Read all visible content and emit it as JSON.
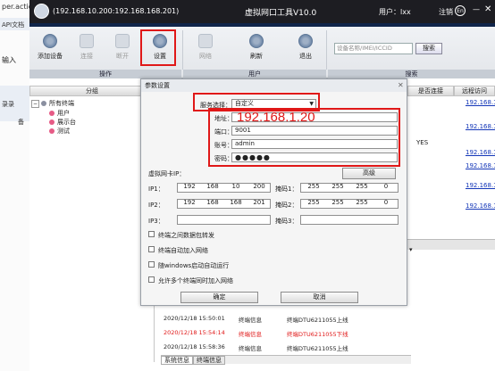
{
  "browser": {
    "url_fragment": "per.actio",
    "tab_fragment": "API文档",
    "input_fragment": "输入",
    "side_fragment": "录录",
    "side_fragment2": "备"
  },
  "window": {
    "title": "(192.168.10.200:192.168.168.201)",
    "app_name": "虚拟网口工具V10.0",
    "user_label": "用户：lxx",
    "logout": "注销",
    "lang": "En"
  },
  "toolbar": {
    "add": "添加设备",
    "connect": "连接",
    "disconnect": "断开",
    "settings": "设置",
    "network": "网络",
    "refresh": "刷新",
    "exit": "退出",
    "search_placeholder": "设备名称/IMEI/ICCID",
    "search_button": "搜索",
    "group_operate": "操作",
    "group_user": "用户",
    "group_search": "搜索"
  },
  "tree": {
    "header": "分组",
    "root": "所有终端",
    "items": [
      "用户",
      "展示台",
      "测试"
    ]
  },
  "table": {
    "col_connect": "是否连接",
    "col_remote": "远程访问",
    "yes": "YES",
    "links": [
      "192.168.1",
      "192.168.1",
      "192.168.1",
      "192.168.1",
      "192.168.1",
      "192.168.1"
    ]
  },
  "logs": [
    {
      "time": "2020/12/18 15:50:01",
      "type": "终端信息",
      "msg": "终端DTU6211055上线",
      "error": false
    },
    {
      "time": "2020/12/18 15:54:14",
      "type": "终端信息",
      "msg": "终端DTU6211055下线",
      "error": true
    },
    {
      "time": "2020/12/18 15:58:36",
      "type": "终端信息",
      "msg": "终端DTU6211055上线",
      "error": false
    }
  ],
  "bottom_tabs": [
    "系统信息",
    "终端信息"
  ],
  "dialog": {
    "title": "参数设置",
    "server_label": "服务选择：",
    "server_value": "自定义",
    "addr_label": "地址：",
    "port_label": "端口：",
    "port_value": "9001",
    "account_label": "账号：",
    "account_value": "admin",
    "password_label": "密码：",
    "password_value": "●●●●●",
    "addr_overlay": "192.168.1.20",
    "vnic_label": "虚拟网卡IP：",
    "advanced": "高级",
    "ip1_label": "IP1：",
    "ip1": [
      "192",
      "168",
      "10",
      "200"
    ],
    "mask1_label": "掩码1：",
    "mask1": [
      "255",
      "255",
      "255",
      "0"
    ],
    "ip2_label": "IP2：",
    "ip2": [
      "192",
      "168",
      "168",
      "201"
    ],
    "mask2_label": "掩码2：",
    "mask2": [
      "255",
      "255",
      "255",
      "0"
    ],
    "ip3_label": "IP3：",
    "mask3_label": "掩码3：",
    "opt1": "终端之间数据包转发",
    "opt2": "终端自动加入网络",
    "opt3": "随windows启动自动运行",
    "opt4": "允许多个终端同时加入网络",
    "ok": "确定",
    "cancel": "取消"
  },
  "colors": {
    "highlight": "#e01818",
    "title_bar": "#1d1d22",
    "link": "#1336b8"
  }
}
